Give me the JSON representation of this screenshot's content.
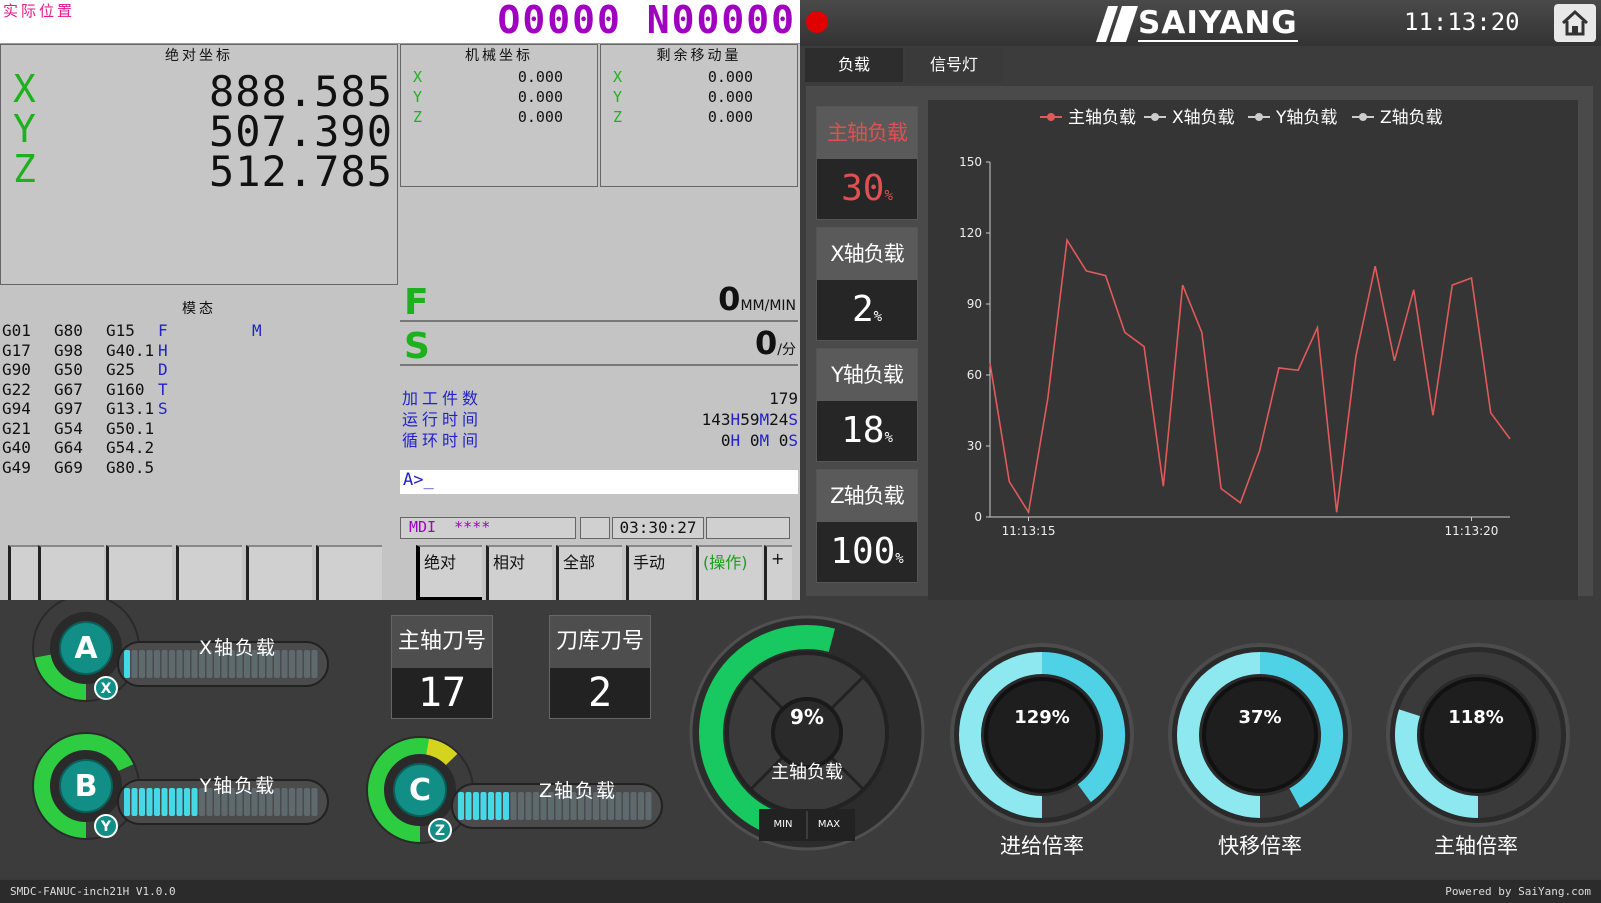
{
  "cnc": {
    "actual_position_label": "实际位置",
    "program_number": "O0000 N00000",
    "absolute": {
      "title": "绝对坐标",
      "axes": [
        {
          "axis": "X",
          "value": "888.585"
        },
        {
          "axis": "Y",
          "value": "507.390"
        },
        {
          "axis": "Z",
          "value": "512.785"
        }
      ]
    },
    "machine": {
      "title": "机械坐标",
      "axes": [
        {
          "axis": "X",
          "value": "0.000"
        },
        {
          "axis": "Y",
          "value": "0.000"
        },
        {
          "axis": "Z",
          "value": "0.000"
        }
      ]
    },
    "remaining": {
      "title": "剩余移动量",
      "axes": [
        {
          "axis": "X",
          "value": "0.000"
        },
        {
          "axis": "Y",
          "value": "0.000"
        },
        {
          "axis": "Z",
          "value": "0.000"
        }
      ]
    },
    "modal": {
      "title": "模态",
      "rows": [
        [
          "G01",
          "G80",
          "G15",
          "F",
          "M"
        ],
        [
          "G17",
          "G98",
          "G40.1",
          "H",
          ""
        ],
        [
          "G90",
          "G50",
          "G25",
          "D",
          ""
        ],
        [
          "G22",
          "G67",
          "G160",
          "T",
          ""
        ],
        [
          "G94",
          "G97",
          "G13.1",
          "S",
          ""
        ],
        [
          "G21",
          "G54",
          "G50.1",
          "",
          ""
        ],
        [
          "G40",
          "G64",
          "G54.2",
          "",
          ""
        ],
        [
          "G49",
          "G69",
          "G80.5",
          "",
          ""
        ]
      ]
    },
    "feed": {
      "label": "F",
      "value": "0",
      "unit": "MM/MIN"
    },
    "spindle": {
      "label": "S",
      "value": "0",
      "unit": "/分"
    },
    "counters": {
      "parts_label": "加工件数",
      "parts_value": "179",
      "run_label": "运行时间",
      "run_h": "143",
      "run_m": "59",
      "run_s": "24",
      "cycle_label": "循环时间",
      "cycle_h": "0",
      "cycle_m": "0",
      "cycle_s": "0"
    },
    "command_prompt": "A>_",
    "mode": "MDI",
    "mode_status": "****",
    "clock": "03:30:27",
    "softkeys": [
      "绝对",
      "相对",
      "全部",
      "手动",
      "(操作)",
      "+"
    ]
  },
  "header": {
    "brand": "SAIYANG",
    "time": "11:13:20",
    "home_icon": "home-icon"
  },
  "tabs": [
    "负载",
    "信号灯"
  ],
  "load_cards": [
    {
      "label": "主轴负载",
      "value": "30",
      "unit": "%",
      "color": "#e05050"
    },
    {
      "label": "X轴负载",
      "value": "2",
      "unit": "%",
      "color": "#ffffff"
    },
    {
      "label": "Y轴负载",
      "value": "18",
      "unit": "%",
      "color": "#ffffff"
    },
    {
      "label": "Z轴负载",
      "value": "100",
      "unit": "%",
      "color": "#ffffff"
    }
  ],
  "chart_data": {
    "type": "line",
    "legend_position": "top",
    "series": [
      {
        "name": "主轴负载",
        "color": "#e05a5a",
        "values": [
          65,
          15,
          2,
          50,
          117,
          104,
          102,
          78,
          72,
          13,
          98,
          78,
          12,
          6,
          28,
          63,
          62,
          80,
          2,
          68,
          106,
          66,
          96,
          43,
          98,
          101,
          44,
          33
        ]
      },
      {
        "name": "X轴负载",
        "color": "#cccccc",
        "values": []
      },
      {
        "name": "Y轴负载",
        "color": "#cccccc",
        "values": []
      },
      {
        "name": "Z轴负载",
        "color": "#cccccc",
        "values": []
      }
    ],
    "x_tick_labels": [
      "11:13:15",
      "11:13:20"
    ],
    "y_ticks": [
      0,
      30,
      60,
      90,
      120,
      150
    ],
    "ylim": [
      0,
      150
    ]
  },
  "axis_bars": [
    {
      "badge": "A",
      "sub": "X",
      "label": "X轴负载",
      "fraction": 0.02,
      "ring_color": "#2ecc40"
    },
    {
      "badge": "B",
      "sub": "Y",
      "label": "Y轴负载",
      "fraction": 0.4,
      "ring_color": "#2ecc40"
    },
    {
      "badge": "C",
      "sub": "Z",
      "label": "Z轴负载",
      "fraction": 0.25,
      "ring_color": "#2ecc40"
    }
  ],
  "tools": [
    {
      "label": "主轴刀号",
      "value": "17"
    },
    {
      "label": "刀库刀号",
      "value": "2"
    }
  ],
  "spindle_gauge": {
    "value": "9%",
    "label": "主轴负载",
    "min_label": "MIN",
    "max_label": "MAX",
    "fraction": 0.42
  },
  "rate_gauges": [
    {
      "value": "129%",
      "label": "进给倍率",
      "fraction": 0.9
    },
    {
      "value": "37%",
      "label": "快移倍率",
      "fraction": 0.92
    },
    {
      "value": "118%",
      "label": "主轴倍率",
      "fraction": 0.3
    }
  ],
  "footer": {
    "version": "SMDC-FANUC-inch21H V1.0.0",
    "powered": "Powered by SaiYang.com"
  }
}
